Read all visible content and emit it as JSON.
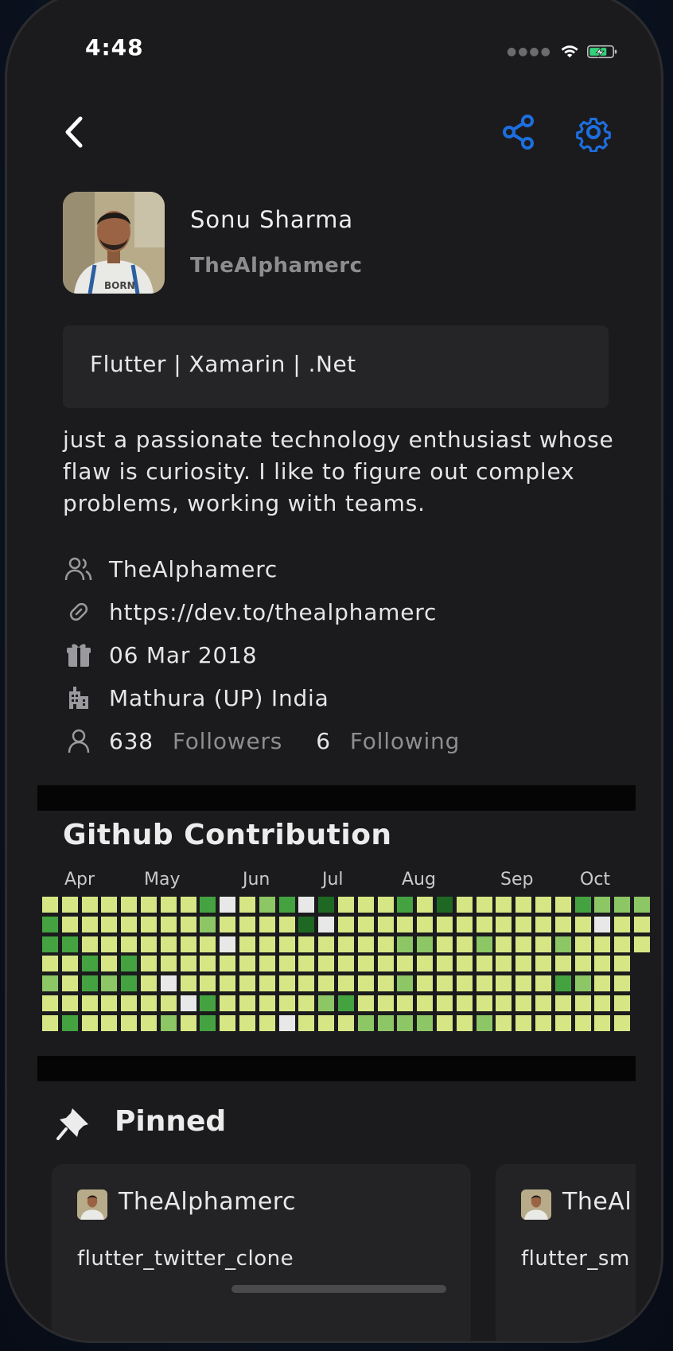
{
  "status_bar": {
    "time": "4:48"
  },
  "header": {
    "back_icon": "chevron-left-icon",
    "share_icon": "share-icon",
    "settings_icon": "gear-icon",
    "accent_color": "#1d6fe0"
  },
  "profile": {
    "name": "Sonu Sharma",
    "login": "TheAlphamerc",
    "headline": "Flutter | Xamarin | .Net",
    "bio": "just a passionate technology enthusiast whose flaw is curiosity. I like to figure out complex problems, working with teams.",
    "company": "TheAlphamerc",
    "blog": "https://dev.to/thealphamerc",
    "joined": "06 Mar 2018",
    "location": "Mathura (UP) India",
    "followers_count": "638",
    "followers_label": "Followers",
    "following_count": "6",
    "following_label": "Following"
  },
  "contribution": {
    "title": "Github Contribution",
    "months": [
      "Apr",
      "May",
      "Jun",
      "Jul",
      "Aug",
      "Sep",
      "Oct"
    ],
    "colors": {
      "0": "#e8e8e8",
      "1": "#d6e685",
      "2": "#8cc665",
      "3": "#44a340",
      "4": "#1e6823"
    },
    "weeks": [
      [
        1,
        3,
        3,
        1,
        2,
        1,
        1
      ],
      [
        1,
        1,
        3,
        1,
        1,
        1,
        3
      ],
      [
        1,
        1,
        1,
        3,
        3,
        1,
        1
      ],
      [
        1,
        1,
        1,
        1,
        2,
        1,
        1
      ],
      [
        1,
        1,
        1,
        3,
        3,
        1,
        1
      ],
      [
        1,
        1,
        1,
        1,
        1,
        1,
        1
      ],
      [
        1,
        1,
        1,
        1,
        0,
        1,
        2
      ],
      [
        1,
        1,
        1,
        1,
        1,
        0,
        1
      ],
      [
        3,
        2,
        1,
        1,
        1,
        3,
        3
      ],
      [
        0,
        1,
        0,
        1,
        1,
        1,
        1
      ],
      [
        1,
        1,
        1,
        1,
        1,
        1,
        1
      ],
      [
        2,
        1,
        1,
        1,
        1,
        1,
        1
      ],
      [
        3,
        1,
        1,
        1,
        1,
        1,
        0
      ],
      [
        0,
        4,
        1,
        1,
        1,
        1,
        1
      ],
      [
        4,
        0,
        1,
        1,
        1,
        2,
        1
      ],
      [
        1,
        1,
        1,
        1,
        1,
        3,
        1
      ],
      [
        1,
        1,
        1,
        1,
        1,
        1,
        2
      ],
      [
        1,
        1,
        1,
        1,
        1,
        1,
        2
      ],
      [
        3,
        1,
        2,
        1,
        2,
        1,
        2
      ],
      [
        1,
        1,
        2,
        1,
        1,
        1,
        2
      ],
      [
        4,
        1,
        1,
        1,
        1,
        1,
        1
      ],
      [
        1,
        1,
        1,
        1,
        1,
        1,
        1
      ],
      [
        1,
        1,
        2,
        1,
        1,
        1,
        2
      ],
      [
        1,
        1,
        1,
        1,
        1,
        1,
        1
      ],
      [
        1,
        1,
        1,
        1,
        1,
        1,
        1
      ],
      [
        1,
        1,
        1,
        1,
        1,
        1,
        1
      ],
      [
        1,
        1,
        2,
        1,
        3,
        1,
        1
      ],
      [
        3,
        1,
        1,
        1,
        2,
        1,
        1
      ],
      [
        2,
        0,
        1,
        1,
        1,
        1,
        1
      ],
      [
        2,
        1,
        1,
        1,
        1,
        1,
        1
      ],
      [
        2,
        1,
        1,
        -1,
        -1,
        -1,
        -1
      ]
    ]
  },
  "pinned": {
    "title": "Pinned",
    "cards": [
      {
        "owner": "TheAlphamerc",
        "repo": "flutter_twitter_clone"
      },
      {
        "owner": "TheAl",
        "repo": "flutter_sm"
      }
    ]
  }
}
